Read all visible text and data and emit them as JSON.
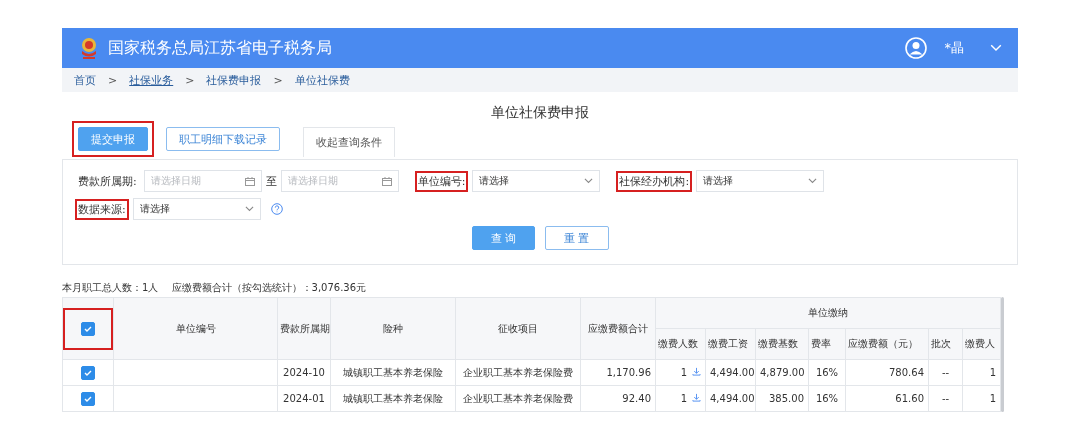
{
  "header": {
    "title": "国家税务总局江苏省电子税务局",
    "user": "*晶"
  },
  "breadcrumb": [
    {
      "label": "首页",
      "underlined": false
    },
    {
      "label": "社保业务",
      "underlined": true
    },
    {
      "label": "社保费申报",
      "underlined": false
    },
    {
      "label": "单位社保费",
      "underlined": false
    }
  ],
  "breadcrumb_separator": ">",
  "page_title": "单位社保费申报",
  "actions": [
    {
      "label": "提交申报",
      "kind": "primary",
      "highlighted": true
    },
    {
      "label": "职工明细下载记录",
      "kind": "outline",
      "highlighted": false
    },
    {
      "label": "收起查询条件",
      "kind": "tab",
      "highlighted": false
    }
  ],
  "filter_rows": [
    [
      {
        "label": "费款所属期:",
        "kind": "date_range",
        "highlighted": false,
        "placeholder": "请选择日期",
        "separator": "至",
        "placeholder_end": "请选择日期"
      },
      {
        "label": "单位编号:",
        "kind": "select",
        "highlighted": true,
        "value": "请选择"
      },
      {
        "label": "社保经办机构:",
        "kind": "select",
        "highlighted": true,
        "value": "请选择"
      }
    ],
    [
      {
        "label": "数据来源:",
        "kind": "select_help",
        "highlighted": true,
        "value": "请选择"
      }
    ]
  ],
  "query_buttons": [
    {
      "label": "查 询",
      "kind": "primary"
    },
    {
      "label": "重 置",
      "kind": "outline"
    }
  ],
  "summary": "本月职工总人数：1人　 应缴费额合计（按勾选统计）：3,076.36元",
  "table": {
    "header_checked": true,
    "header_highlighted": true,
    "columns": [
      "单位编号",
      "费款所属期",
      "险种",
      "征收项目",
      "应缴费额合计"
    ],
    "group": "单位缴纳",
    "group_columns": [
      "缴费人数",
      "缴费工资",
      "缴费基数",
      "费率",
      "应缴费额（元）",
      "批次",
      "缴费人"
    ],
    "rows": [
      {
        "checked": true,
        "cells": [
          "",
          "2024-10",
          "城镇职工基本养老保险",
          "企业职工基本养老保险费",
          "1,170.96"
        ],
        "group_cells": [
          "1",
          "4,494.00",
          "4,879.00",
          "16%",
          "780.64",
          "--",
          "1"
        ]
      },
      {
        "checked": true,
        "cells": [
          "",
          "2024-01",
          "城镇职工基本养老保险",
          "企业职工基本养老保险费",
          "92.40"
        ],
        "group_cells": [
          "1",
          "4,494.00",
          "385.00",
          "16%",
          "61.60",
          "--",
          "1"
        ]
      }
    ]
  }
}
